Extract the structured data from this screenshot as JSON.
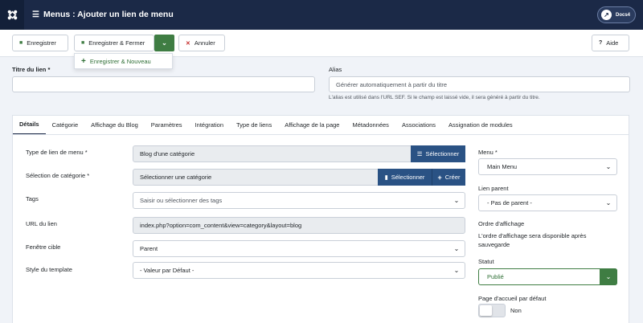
{
  "header": {
    "title": "Menus : Ajouter un lien de menu",
    "user_label": "Docs4"
  },
  "toolbar": {
    "save_label": "Enregistrer",
    "save_close_label": "Enregistrer & Fermer",
    "cancel_label": "Annuler",
    "help_label": "Aide",
    "dropdown_item": "Enregistrer & Nouveau"
  },
  "form": {
    "title_label": "Titre du lien *",
    "title_value": "",
    "alias_label": "Alias",
    "alias_placeholder": "Générer automatiquement à partir du titre",
    "alias_hint": "L'alias est utilisé dans l'URL SEF. Si le champ est laissé vide, il sera généré à partir du titre."
  },
  "tabs": [
    "Détails",
    "Catégorie",
    "Affichage du Blog",
    "Paramètres",
    "Intégration",
    "Type de liens",
    "Affichage de la page",
    "Métadonnées",
    "Associations",
    "Assignation de modules"
  ],
  "details": {
    "menu_type_label": "Type de lien de menu *",
    "menu_type_value": "Blog d'une catégorie",
    "select_btn": "Sélectionner",
    "category_label": "Sélection de catégorie *",
    "category_value": "Sélectionner une catégorie",
    "category_select_btn": "Sélectionner",
    "create_btn": "Créer",
    "tags_label": "Tags",
    "tags_placeholder": "Saisir ou sélectionner des tags",
    "url_label": "URL du lien",
    "url_value": "index.php?option=com_content&view=category&layout=blog",
    "target_label": "Fenêtre cible",
    "target_value": "Parent",
    "template_label": "Style du template",
    "template_value": "- Valeur par Défaut -"
  },
  "sidebar": {
    "menu_label": "Menu *",
    "menu_value": "Main Menu",
    "parent_label": "Lien parent",
    "parent_value": "- Pas de parent -",
    "order_label": "Ordre d'affichage",
    "order_text": "L'ordre d'affichage sera disponible après sauvegarde",
    "status_label": "Statut",
    "status_value": "Publié",
    "home_label": "Page d'accueil par défaut",
    "home_value": "Non"
  },
  "colors": {
    "header_bg": "#1b2947",
    "success_green": "#3f7d43",
    "primary_blue": "#2a5284",
    "danger_red": "#c52827"
  }
}
